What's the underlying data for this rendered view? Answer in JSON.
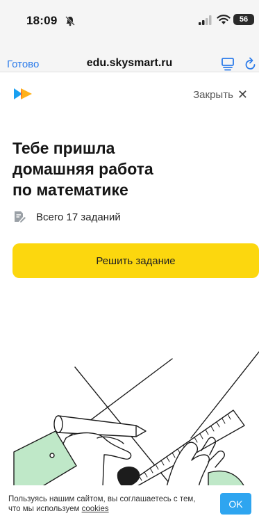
{
  "status_bar": {
    "time": "18:09",
    "battery": "56"
  },
  "browser": {
    "done_label": "Готово",
    "url": "edu.skysmart.ru"
  },
  "header": {
    "close_label": "Закрыть",
    "close_glyph": "✕"
  },
  "homework": {
    "title_lines": [
      "Тебе пришла",
      "домашняя работа",
      "по математике"
    ],
    "task_count": "Всего 17 заданий",
    "solve_label": "Решить задание"
  },
  "cookie": {
    "text": "Пользуясь нашим сайтом, вы соглашаетесь с тем, что мы используем ",
    "link_label": "cookies",
    "ok_label": "OK"
  },
  "colors": {
    "accent_blue": "#2b7bea",
    "solve_yellow": "#fcd70e",
    "ok_blue": "#2ea5f0"
  },
  "icons": [
    "bell-muted-icon",
    "signal-icon",
    "wifi-icon",
    "battery-icon",
    "reader-icon",
    "reload-icon",
    "skysmart-logo",
    "close-icon",
    "homework-icon"
  ]
}
